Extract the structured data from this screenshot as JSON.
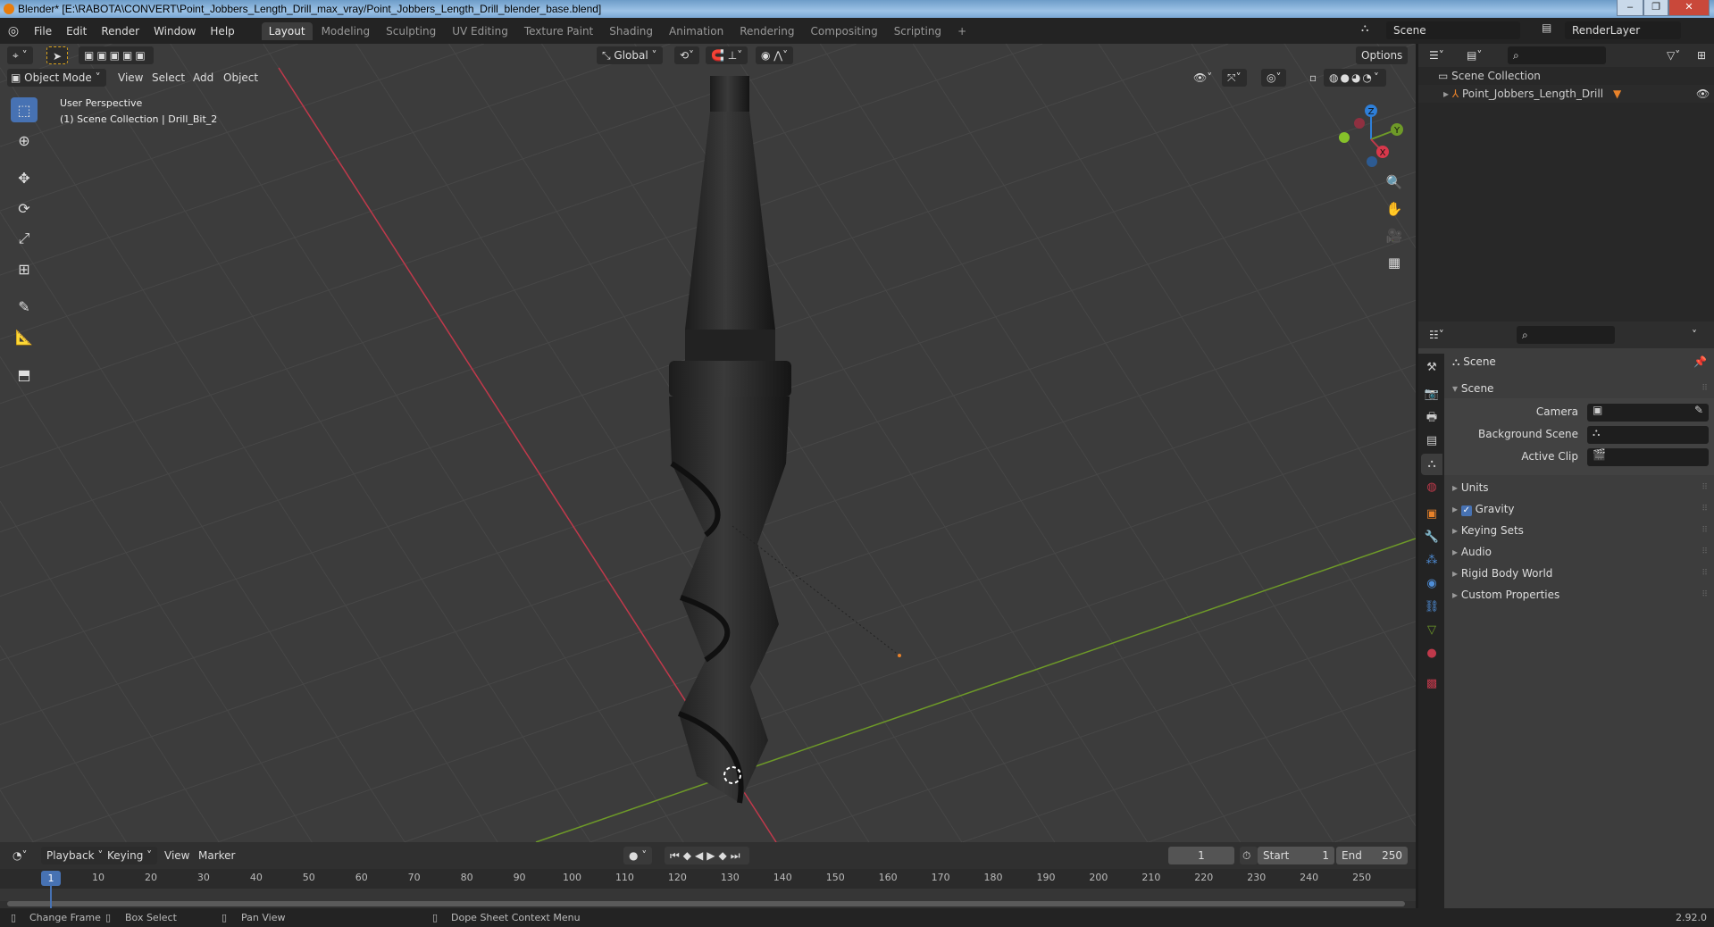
{
  "window": {
    "title": "Blender* [E:\\RABOTA\\CONVERT\\Point_Jobbers_Length_Drill_max_vray/Point_Jobbers_Length_Drill_blender_base.blend]",
    "minimize": "–",
    "maximize": "❐",
    "close": "✕"
  },
  "menubar": {
    "items": [
      "File",
      "Edit",
      "Render",
      "Window",
      "Help"
    ],
    "workspaces": [
      "Layout",
      "Modeling",
      "Sculpting",
      "UV Editing",
      "Texture Paint",
      "Shading",
      "Animation",
      "Rendering",
      "Compositing",
      "Scripting"
    ],
    "active_workspace": "Layout",
    "add": "+",
    "scene": "Scene",
    "view_layer": "RenderLayer"
  },
  "viewport": {
    "transform_orientation": "Global",
    "options": "Options",
    "mode": "Object Mode",
    "menus": [
      "View",
      "Select",
      "Add",
      "Object"
    ],
    "overlay_line1": "User Perspective",
    "overlay_line2": "(1) Scene Collection | Drill_Bit_2",
    "gizmo": {
      "x": "X",
      "y": "Y",
      "z": "Z"
    },
    "axis_colors": {
      "x": "#c0394b",
      "y": "#6e9a28",
      "z": "#2e7fd9"
    }
  },
  "outliner": {
    "root": "Scene Collection",
    "items": [
      {
        "name": "Point_Jobbers_Length_Drill",
        "visible": true
      }
    ]
  },
  "properties": {
    "context": "Scene",
    "panel": "Scene",
    "fields": [
      {
        "label": "Camera"
      },
      {
        "label": "Background Scene"
      },
      {
        "label": "Active Clip"
      }
    ],
    "subpanels": [
      {
        "label": "Units"
      },
      {
        "label": "Gravity",
        "checked": true
      },
      {
        "label": "Keying Sets"
      },
      {
        "label": "Audio"
      },
      {
        "label": "Rigid Body World"
      },
      {
        "label": "Custom Properties"
      }
    ]
  },
  "timeline": {
    "menus": [
      "Playback",
      "Keying",
      "View",
      "Marker"
    ],
    "current_frame": "1",
    "start_label": "Start",
    "start": "1",
    "end_label": "End",
    "end": "250",
    "ticks": [
      "10",
      "20",
      "30",
      "40",
      "50",
      "60",
      "70",
      "80",
      "90",
      "100",
      "110",
      "120",
      "130",
      "140",
      "150",
      "160",
      "170",
      "180",
      "190",
      "200",
      "210",
      "220",
      "230",
      "240",
      "250"
    ],
    "playhead": "1"
  },
  "statusbar": {
    "hints": [
      "Change Frame",
      "Box Select",
      "Pan View",
      "Dope Sheet Context Menu"
    ],
    "version": "2.92.0"
  }
}
